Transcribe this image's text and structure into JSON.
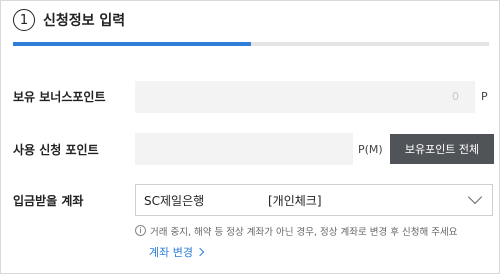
{
  "step": {
    "number": "1",
    "title": "신청정보 입력",
    "progress": 0.5
  },
  "bonus_points": {
    "label": "보유 보너스포인트",
    "value": "0",
    "unit": "P"
  },
  "use_points": {
    "label": "사용 신청 포인트",
    "value": "",
    "unit": "P(M)",
    "all_button_label": "보유포인트 전체"
  },
  "deposit_account": {
    "label": "입금받을 계좌",
    "bank": "SC제일은행",
    "account_type": "[개인체크]",
    "notice": "거래 중지, 해약 등 정상 계좌가 아닌 경우, 정상 계좌로 변경 후 신청해 주세요",
    "change_link_label": "계좌 변경"
  },
  "colors": {
    "accent": "#2f7fd8",
    "button_bg": "#505459",
    "field_bg": "#f3f3f3"
  }
}
